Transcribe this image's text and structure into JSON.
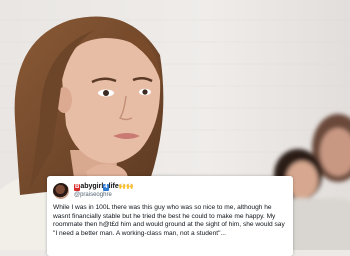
{
  "tweet": {
    "display_name_prefix": "abygirl",
    "display_name_mid": "life",
    "badge_b": "B",
    "badge_4": "4",
    "hands_emoji": "🙌🙌",
    "handle": "@praiseoghre",
    "text": "While I was in 100L there was this guy who was so nice to me, although he wasnt financially stable but he tried the best he could to make me happy. My roommate then h@t£d him and would ground at the sight of him, she would say \"I need a better man. A working-class man, not a student\"..."
  },
  "colors": {
    "wall": "#ece9e6",
    "sweater": "#f2efe9",
    "hair": "#7a4b2a",
    "skin": "#e4b8a0",
    "card": "#ffffff"
  }
}
